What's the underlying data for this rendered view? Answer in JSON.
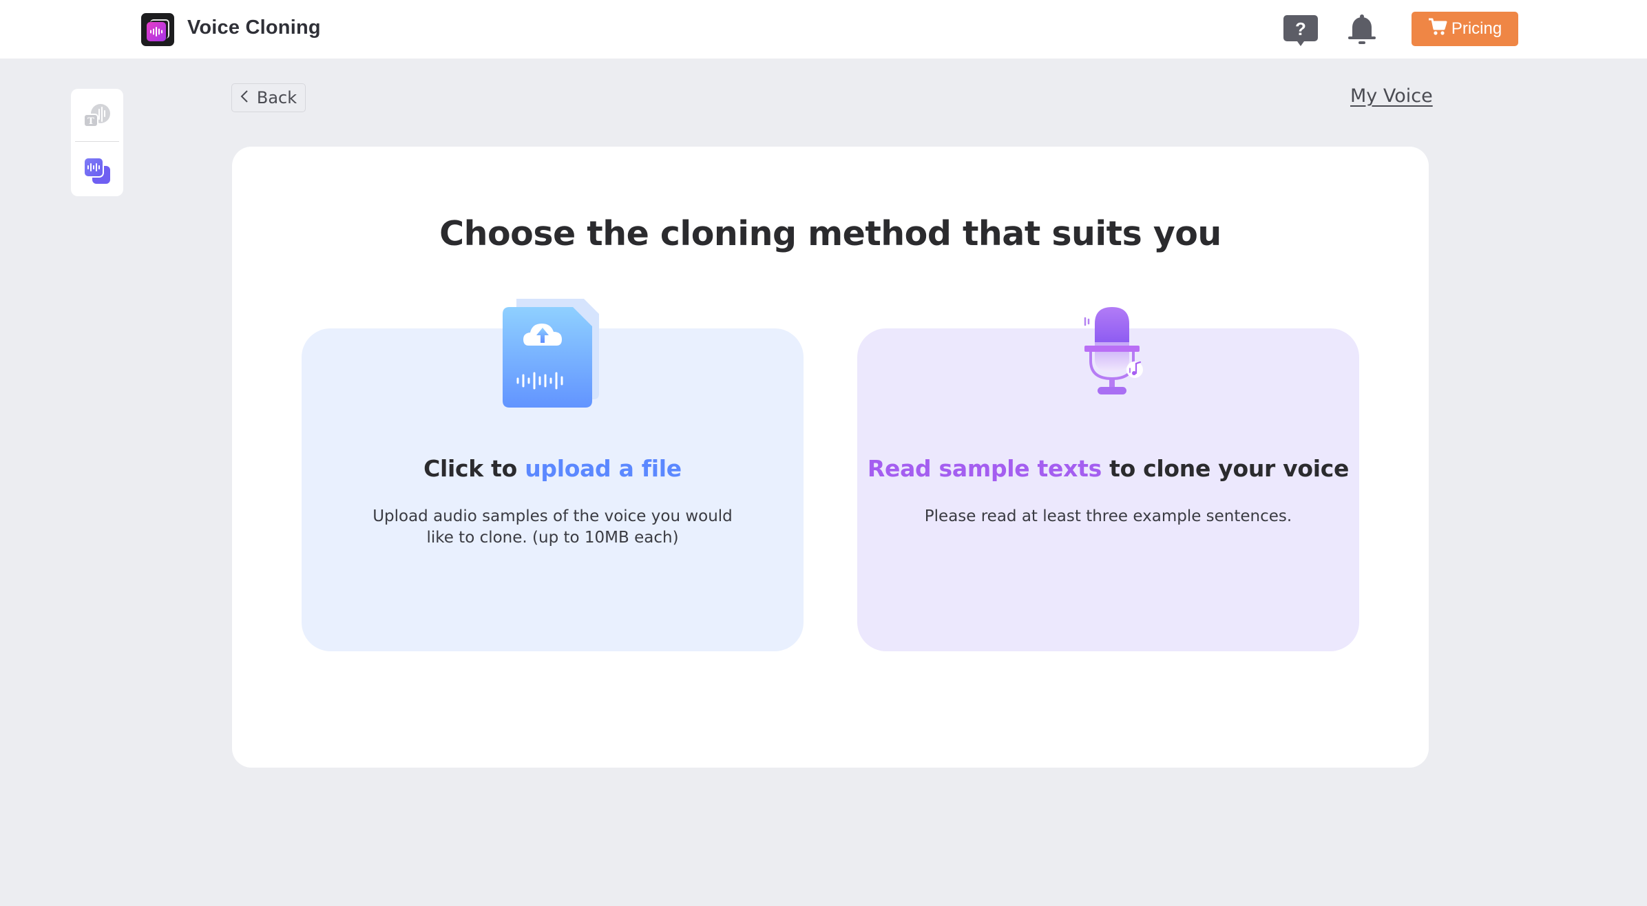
{
  "header": {
    "app_title": "Voice Cloning",
    "pricing_label": "Pricing",
    "icons": {
      "logo": "voice-wave-logo",
      "help": "help-question-icon",
      "notifications": "bell-icon",
      "cart": "cart-icon"
    }
  },
  "sidebar": {
    "items": [
      {
        "name": "text-to-speech",
        "icon": "tts-icon",
        "active": false
      },
      {
        "name": "voice-cloning",
        "icon": "voice-clone-icon",
        "active": true
      }
    ]
  },
  "nav": {
    "back_label": "Back",
    "my_voice_label": "My Voice"
  },
  "main": {
    "title": "Choose the cloning method that suits you",
    "options": [
      {
        "id": "upload",
        "title_prefix": "Click to ",
        "title_highlight": "upload a file",
        "title_suffix": "",
        "description": "Upload audio samples of the voice you would like to clone. (up to 10MB each)",
        "icon": "upload-audio-file-icon"
      },
      {
        "id": "record",
        "title_prefix": "",
        "title_highlight": "Read sample texts",
        "title_suffix": " to clone your voice",
        "description": "Please read at least three example sentences.",
        "icon": "microphone-icon"
      }
    ]
  },
  "colors": {
    "accent_orange": "#ef8645",
    "accent_blue": "#5b88ff",
    "accent_purple": "#a45ef0",
    "upload_card_bg": "#e9f0fe",
    "record_card_bg": "#ece8fd",
    "page_bg": "#ecedf1"
  }
}
